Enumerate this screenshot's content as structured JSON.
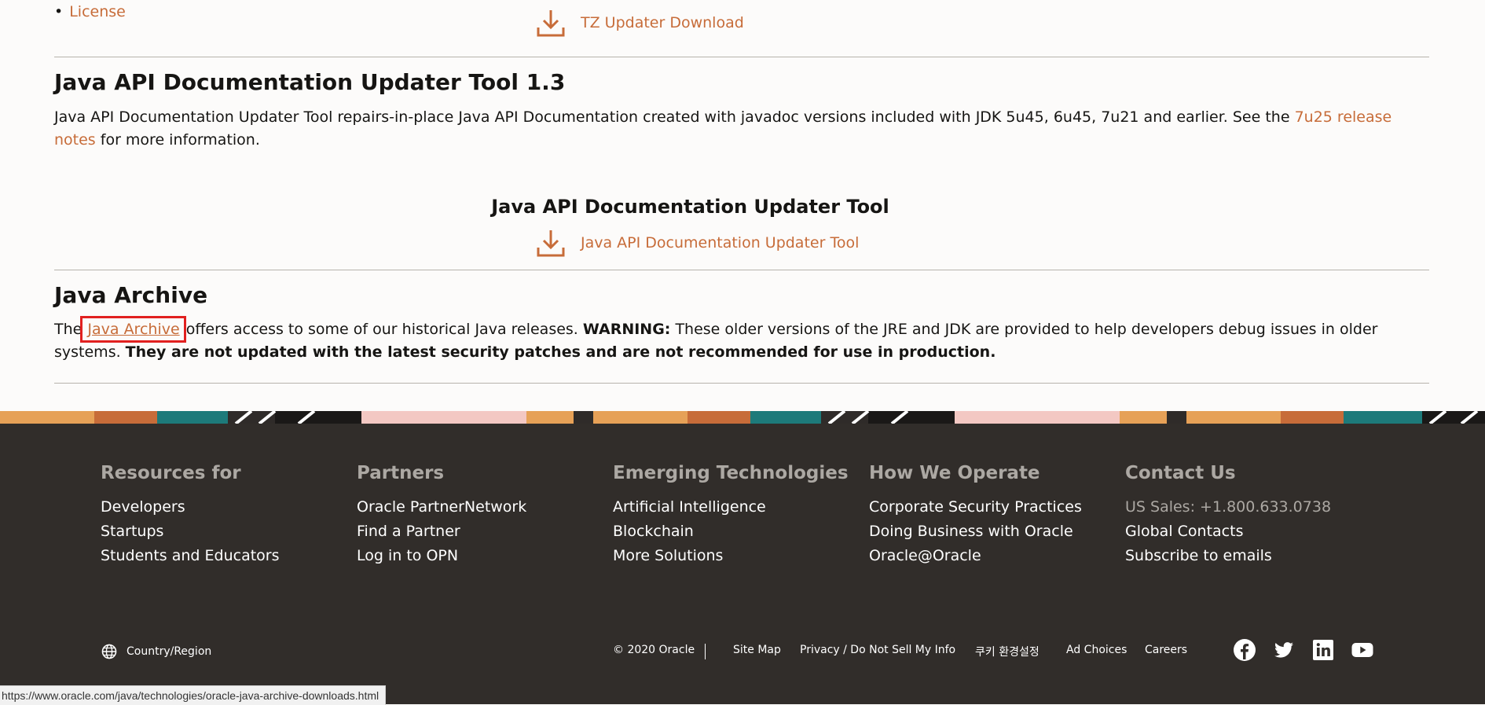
{
  "list": {
    "license_label": "License"
  },
  "tz": {
    "download_label": "TZ Updater Download"
  },
  "api_doc": {
    "heading": "Java API Documentation Updater Tool 1.3",
    "para_before": "Java API Documentation Updater Tool repairs-in-place Java API Documentation created with javadoc versions included with JDK 5u45, 6u45, 7u21 and earlier.  See the ",
    "release_notes_link": "7u25 release notes",
    "para_after": " for more information.",
    "center_title": "Java API Documentation Updater Tool",
    "download_label": "Java API Documentation Updater Tool"
  },
  "archive": {
    "heading": "Java Archive",
    "text_the": "The ",
    "link": "Java Archive",
    "text_after_link": " offers access to some of our historical Java releases. ",
    "warning_label": "WARNING:",
    "warning_text": " These older versions of the JRE and JDK are provided to help developers debug issues in older systems. ",
    "bold_notice": "They are not updated with the latest security patches and are not recommended for use in production."
  },
  "footer": {
    "columns": [
      {
        "title": "Resources for",
        "items": [
          "Developers",
          "Startups",
          "Students and Educators"
        ]
      },
      {
        "title": "Partners",
        "items": [
          "Oracle PartnerNetwork",
          "Find a Partner",
          "Log in to OPN"
        ]
      },
      {
        "title": "Emerging Technologies",
        "items": [
          "Artificial Intelligence",
          "Blockchain",
          "More Solutions"
        ]
      },
      {
        "title": "How We Operate",
        "items": [
          "Corporate Security Practices",
          "Doing Business with Oracle",
          "Oracle@Oracle"
        ]
      },
      {
        "title": "Contact Us",
        "items": [
          "US Sales: +1.800.633.0738",
          "Global Contacts",
          "Subscribe to emails"
        ]
      }
    ],
    "region_label": "Country/Region",
    "copyright": "© 2020 Oracle",
    "links": [
      "Site Map",
      "Privacy / Do Not Sell My Info",
      "쿠키 환경설정",
      "Ad Choices",
      "Careers"
    ],
    "social": [
      "facebook-icon",
      "twitter-icon",
      "linkedin-icon",
      "youtube-icon"
    ]
  },
  "status_bar": {
    "url": "https://www.oracle.com/java/technologies/oracle-java-archive-downloads.html"
  },
  "colors": {
    "link": "#c76c39",
    "footer_bg": "#312d2a",
    "highlight": "#e1201f"
  }
}
